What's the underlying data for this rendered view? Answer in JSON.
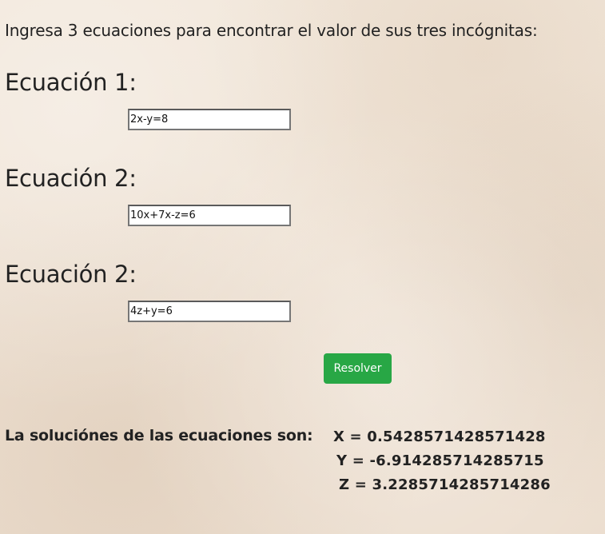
{
  "instructions": "Ingresa 3 ecuaciones para encontrar el valor de sus tres incógnitas:",
  "equations": [
    {
      "label": "Ecuación 1:",
      "value": "2x-y=8"
    },
    {
      "label": "Ecuación 2:",
      "value": "10x+7x-z=6"
    },
    {
      "label": "Ecuación 2:",
      "value": "4z+y=6"
    }
  ],
  "solve_button": {
    "label": "Resolver",
    "color": "#28a745"
  },
  "results": {
    "label": "La soluciónes de las ecuaciones son:",
    "x": "X = 0.5428571428571428",
    "y": "Y = -6.914285714285715",
    "z": "Z = 3.2285714285714286"
  }
}
